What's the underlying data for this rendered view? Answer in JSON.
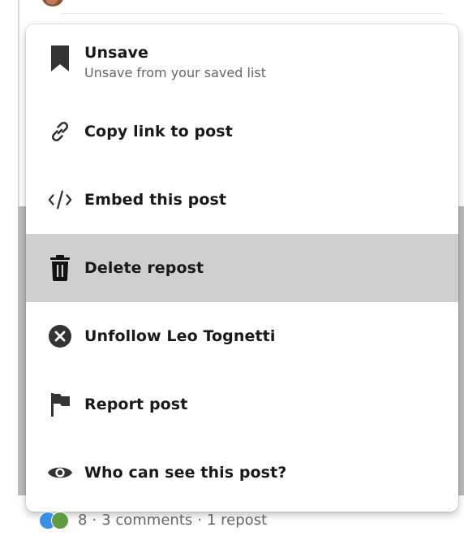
{
  "menu": {
    "items": [
      {
        "id": "unsave",
        "title": "Unsave",
        "subtitle": "Unsave from your saved list",
        "icon": "bookmark-icon"
      },
      {
        "id": "copy-link",
        "title": "Copy link to post",
        "icon": "link-icon"
      },
      {
        "id": "embed",
        "title": "Embed this post",
        "icon": "code-icon"
      },
      {
        "id": "delete",
        "title": "Delete repost",
        "icon": "trash-icon",
        "highlighted": true
      },
      {
        "id": "unfollow",
        "title": "Unfollow Leo Tognetti",
        "icon": "close-circle-icon"
      },
      {
        "id": "report",
        "title": "Report post",
        "icon": "flag-icon"
      },
      {
        "id": "visibility",
        "title": "Who can see this post?",
        "icon": "eye-icon"
      }
    ]
  },
  "footer": {
    "reaction_count": "8",
    "separator": "·",
    "comments": "3 comments",
    "reposts": "1 repost"
  },
  "colors": {
    "highlight": "#cfcfcf",
    "icon": "#333333",
    "text": "#191919",
    "subtext": "#666666"
  }
}
